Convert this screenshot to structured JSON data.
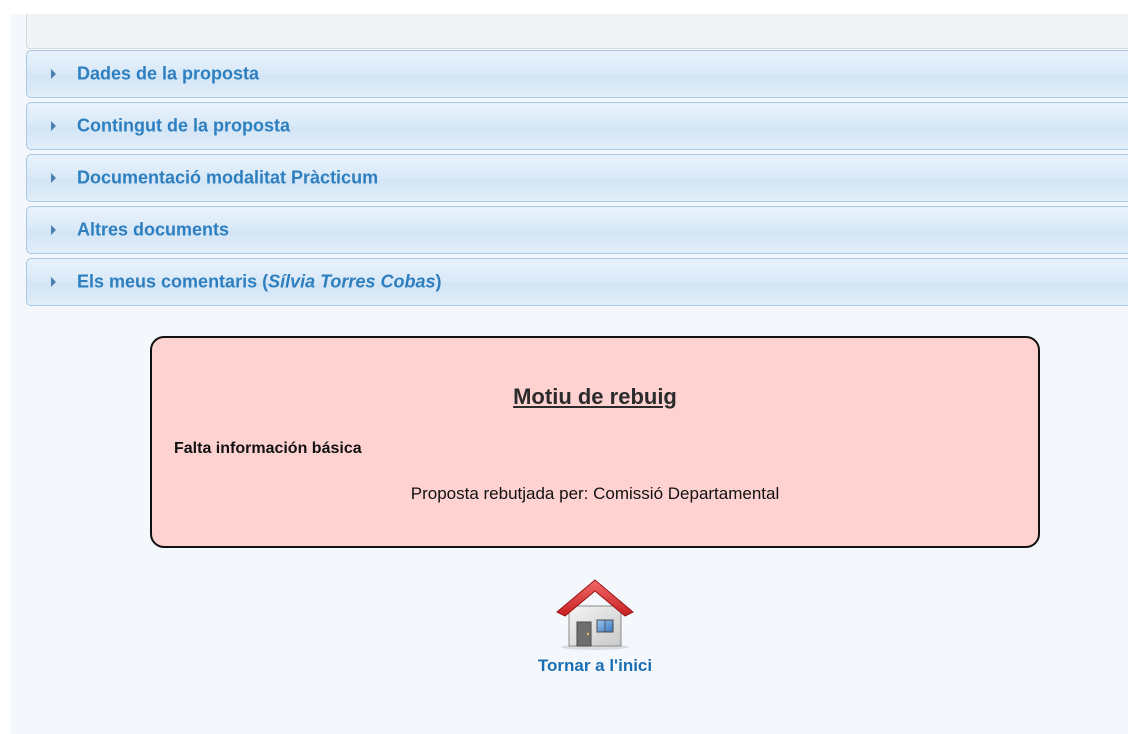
{
  "sections": [
    {
      "label": "Dades de la proposta"
    },
    {
      "label": "Contingut de la proposta"
    },
    {
      "label": "Documentació modalitat Pràcticum"
    },
    {
      "label": "Altres documents"
    },
    {
      "label_prefix": "Els meus comentaris (",
      "label_name": "Sílvia Torres Cobas",
      "label_suffix": ")"
    }
  ],
  "rejection": {
    "title": "Motiu de rebuig",
    "reason": "Falta información básica",
    "rejected_by": "Proposta rebutjada per: Comissió Departamental"
  },
  "home": {
    "label": "Tornar a l'inici",
    "icon": "home-icon"
  },
  "colors": {
    "section_text": "#2d7fbf",
    "reject_background": "#ffd2d2",
    "link": "#1a6fb3"
  }
}
